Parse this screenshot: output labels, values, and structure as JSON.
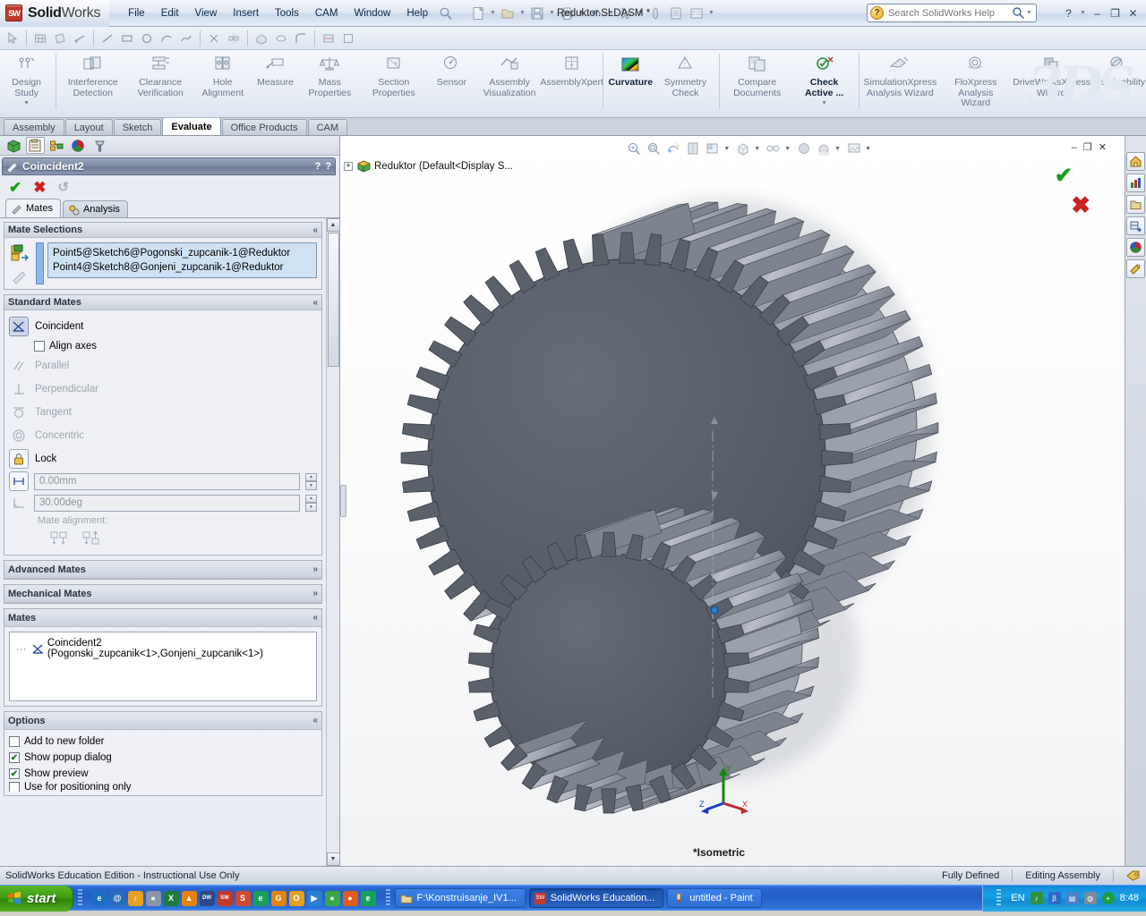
{
  "app": {
    "brand_bold": "Solid",
    "brand_light": "Works",
    "logo_text": "SW",
    "document_title": "Reduktor.SLDASM *"
  },
  "menubar": {
    "items": [
      "File",
      "Edit",
      "View",
      "Insert",
      "Tools",
      "CAM",
      "Window",
      "Help"
    ],
    "search_icon": "search-help-icon"
  },
  "search": {
    "placeholder": "Search SolidWorks Help",
    "badge": "?"
  },
  "window_controls": {
    "help": "?",
    "minimize": "–",
    "restore": "❐",
    "close": "✕"
  },
  "ribbon": {
    "groups": [
      {
        "items": [
          {
            "label": "Design Study",
            "icon": "design-study-icon",
            "active": false,
            "dropdown": true
          }
        ]
      },
      {
        "items": [
          {
            "label": "Interference Detection",
            "icon": "interference-detection-icon",
            "active": false
          },
          {
            "label": "Clearance Verification",
            "icon": "clearance-verification-icon",
            "active": false
          },
          {
            "label": "Hole Alignment",
            "icon": "hole-alignment-icon",
            "active": false
          },
          {
            "label": "Measure",
            "icon": "measure-icon",
            "active": false
          },
          {
            "label": "Mass Properties",
            "icon": "mass-properties-icon",
            "active": false
          },
          {
            "label": "Section Properties",
            "icon": "section-properties-icon",
            "active": false
          },
          {
            "label": "Sensor",
            "icon": "sensor-icon",
            "active": false
          },
          {
            "label": "Assembly Visualization",
            "icon": "assembly-visualization-icon",
            "active": false
          },
          {
            "label": "AssemblyXpert",
            "icon": "assemblyxpert-icon",
            "active": false
          }
        ]
      },
      {
        "items": [
          {
            "label": "Curvature",
            "icon": "curvature-icon",
            "active": true
          },
          {
            "label": "Symmetry Check",
            "icon": "symmetry-check-icon",
            "active": false
          }
        ]
      },
      {
        "items": [
          {
            "label": "Compare Documents",
            "icon": "compare-documents-icon",
            "active": false
          },
          {
            "label": "Check Active ...",
            "icon": "check-active-icon",
            "active": true,
            "dropdown": true
          }
        ]
      },
      {
        "items": [
          {
            "label": "SimulationXpress Analysis Wizard",
            "icon": "simulationxpress-icon",
            "active": false
          },
          {
            "label": "FloXpress Analysis Wizard",
            "icon": "floxpress-icon",
            "active": false
          },
          {
            "label": "DriveWorksXpress Wizard",
            "icon": "driveworksxpress-icon",
            "active": false
          },
          {
            "label": "Sustainability",
            "icon": "sustainability-icon",
            "active": false
          }
        ]
      }
    ],
    "watermark": "3DS"
  },
  "tabs": [
    {
      "label": "Assembly",
      "active": false
    },
    {
      "label": "Layout",
      "active": false
    },
    {
      "label": "Sketch",
      "active": false
    },
    {
      "label": "Evaluate",
      "active": true
    },
    {
      "label": "Office Products",
      "active": false
    },
    {
      "label": "CAM",
      "active": false
    }
  ],
  "feature_manager_toolbar": {
    "icons": [
      {
        "name": "feature-manager-tree-icon",
        "selected": false
      },
      {
        "name": "property-manager-icon",
        "selected": true
      },
      {
        "name": "configuration-manager-icon",
        "selected": false
      },
      {
        "name": "display-manager-icon",
        "selected": false
      },
      {
        "name": "cam-manager-icon",
        "selected": false
      }
    ]
  },
  "property_manager": {
    "title": "Coincident2",
    "title_icon": "mate-icon",
    "help_pin": "?",
    "help": "?",
    "actions": {
      "ok": "✔",
      "cancel": "✖",
      "undo": "↺"
    },
    "tabs": [
      {
        "label": "Mates",
        "icon": "mates-icon",
        "active": true
      },
      {
        "label": "Analysis",
        "icon": "analysis-icon",
        "active": false
      }
    ],
    "mate_selections": {
      "title": "Mate Selections",
      "collapse": "«",
      "entities_icon": "entities-to-mate-icon",
      "multiple_mate_icon": "multiple-mate-mode-icon",
      "selections": [
        "Point5@Sketch6@Pogonski_zupcanik-1@Reduktor",
        "Point4@Sketch8@Gonjeni_zupcanik-1@Reduktor"
      ]
    },
    "standard_mates": {
      "title": "Standard Mates",
      "collapse": "«",
      "items": [
        {
          "label": "Coincident",
          "icon": "coincident-icon",
          "selected": true,
          "disabled": false
        },
        {
          "label": "Parallel",
          "icon": "parallel-icon",
          "selected": false,
          "disabled": true
        },
        {
          "label": "Perpendicular",
          "icon": "perpendicular-icon",
          "selected": false,
          "disabled": true
        },
        {
          "label": "Tangent",
          "icon": "tangent-icon",
          "selected": false,
          "disabled": true
        },
        {
          "label": "Concentric",
          "icon": "concentric-icon",
          "selected": false,
          "disabled": true
        },
        {
          "label": "Lock",
          "icon": "lock-icon",
          "selected": false,
          "disabled": false
        }
      ],
      "align_axes": {
        "label": "Align axes",
        "checked": false
      },
      "distance_value": "0.00mm",
      "angle_value": "30.00deg",
      "mate_alignment_label": "Mate alignment:",
      "alignment_buttons": [
        {
          "name": "aligned-button"
        },
        {
          "name": "anti-aligned-button"
        }
      ]
    },
    "advanced_mates": {
      "title": "Advanced Mates",
      "collapse": "»"
    },
    "mechanical_mates": {
      "title": "Mechanical Mates",
      "collapse": "»"
    },
    "mates": {
      "title": "Mates",
      "collapse": "«",
      "items": [
        {
          "label": "Coincident2 (Pogonski_zupcanik<1>,Gonjeni_zupcanik<1>)",
          "icon": "coincident-mate-icon"
        }
      ]
    },
    "options": {
      "title": "Options",
      "collapse": "«",
      "items": [
        {
          "label": "Add to new folder",
          "checked": false
        },
        {
          "label": "Show popup dialog",
          "checked": true
        },
        {
          "label": "Show preview",
          "checked": true
        },
        {
          "label": "Use for positioning only",
          "checked": false
        }
      ]
    }
  },
  "graphics": {
    "tree_root": "Reduktor  (Default<Display S...",
    "tree_expander": "+",
    "tree_icon": "assembly-icon",
    "view_toolbar": [
      {
        "name": "zoom-to-fit-icon"
      },
      {
        "name": "zoom-to-area-icon"
      },
      {
        "name": "previous-view-icon"
      },
      {
        "name": "section-view-icon"
      },
      {
        "name": "view-orientation-icon",
        "dropdown": true
      },
      {
        "name": "display-style-icon",
        "dropdown": true
      },
      {
        "name": "hide-show-items-icon",
        "dropdown": true
      },
      {
        "name": "edit-appearance-icon"
      },
      {
        "name": "apply-scene-icon",
        "dropdown": true
      },
      {
        "name": "view-settings-icon",
        "dropdown": true
      }
    ],
    "window_controls": {
      "minimize": "–",
      "restore": "❐",
      "close": "✕"
    },
    "confirm_ok": "✔",
    "confirm_cancel": "✖",
    "view_label": "*Isometric",
    "triad": {
      "x": "X",
      "y": "Y",
      "z": "Z"
    },
    "model": {
      "name": "Reduktor gear assembly",
      "big_gear_teeth": 48,
      "small_gear_teeth": 30,
      "face_color": "#5b616b",
      "edge_color": "#3a3f47",
      "side_color": "#a8adb8"
    }
  },
  "task_pane": [
    {
      "name": "sw-resources-icon"
    },
    {
      "name": "design-library-icon"
    },
    {
      "name": "file-explorer-icon"
    },
    {
      "name": "view-palette-icon"
    },
    {
      "name": "appearances-scenes-icon"
    },
    {
      "name": "custom-properties-icon"
    }
  ],
  "statusbar": {
    "left": "SolidWorks Education Edition - Instructional Use Only",
    "defined_state": "Fully Defined",
    "editing_state": "Editing Assembly",
    "tag_icon": "tag-icon"
  },
  "taskbar": {
    "start_label": "start",
    "quick_launch": [
      {
        "name": "internet-explorer-icon",
        "color": "#1a6fc4",
        "glyph": "e"
      },
      {
        "name": "outlook-icon",
        "color": "#2b6cb8",
        "glyph": "@"
      },
      {
        "name": "media-icon",
        "color": "#e8a020",
        "glyph": "♪"
      },
      {
        "name": "network-icon",
        "color": "#8a96a8",
        "glyph": "●"
      },
      {
        "name": "excel-icon",
        "color": "#1f7a3f",
        "glyph": "X"
      },
      {
        "name": "vlc-icon",
        "color": "#e8820c",
        "glyph": "▲"
      },
      {
        "name": "dw-icon",
        "color": "#2a4a8c",
        "glyph": "DW"
      },
      {
        "name": "solidworks-icon",
        "color": "#c0392b",
        "glyph": "SW"
      },
      {
        "name": "solidworks-alt-icon",
        "color": "#d04a30",
        "glyph": "S"
      },
      {
        "name": "edge-icon",
        "color": "#17a05a",
        "glyph": "e"
      },
      {
        "name": "google-icon",
        "color": "#e8820c",
        "glyph": "G"
      },
      {
        "name": "opera-icon",
        "color": "#e8a020",
        "glyph": "O"
      },
      {
        "name": "media-player-icon",
        "color": "#2a7fd4",
        "glyph": "▶"
      },
      {
        "name": "chrome-icon",
        "color": "#3aa84a",
        "glyph": "●"
      },
      {
        "name": "firefox-icon",
        "color": "#e05a18",
        "glyph": "●"
      },
      {
        "name": "edge-alt-icon",
        "color": "#17a05a",
        "glyph": "e"
      }
    ],
    "windows": [
      {
        "label": "F:\\Konstruisanje_IV1...",
        "icon": "folder-icon",
        "active": false
      },
      {
        "label": "SolidWorks Education...",
        "icon": "solidworks-icon",
        "active": true
      },
      {
        "label": "untitled - Paint",
        "icon": "paint-icon",
        "active": false
      }
    ],
    "language": "EN",
    "tray": [
      {
        "name": "volume-icon",
        "color": "#2f8f3f"
      },
      {
        "name": "bluetooth-icon",
        "color": "#2a6cc4"
      },
      {
        "name": "network-icon",
        "color": "#4a80c8"
      },
      {
        "name": "shield-icon",
        "color": "#7a8a98"
      },
      {
        "name": "update-icon",
        "color": "#1f9a3f"
      }
    ],
    "clock": "8:48"
  }
}
